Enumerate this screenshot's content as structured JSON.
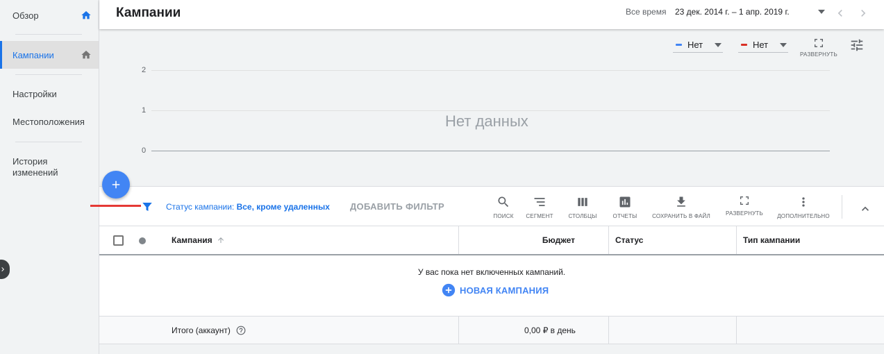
{
  "sidebar": {
    "items": [
      {
        "label": "Обзор"
      },
      {
        "label": "Кампании"
      },
      {
        "label": "Настройки"
      },
      {
        "label": "Местоположения"
      },
      {
        "label": "История изменений"
      }
    ]
  },
  "header": {
    "title": "Кампании",
    "date_label": "Все время",
    "date_range": "23 дек. 2014 г. – 1 апр. 2019 г."
  },
  "chart": {
    "metric1": "Нет",
    "metric2": "Нет",
    "metric1_color": "#4285f4",
    "metric2_color": "#d93025",
    "expand_label": "РАЗВЕРНУТЬ",
    "y_ticks": [
      "2",
      "1",
      "0"
    ],
    "no_data": "Нет данных"
  },
  "filter": {
    "prefix": "Статус кампании:",
    "value": "Все, кроме удаленных",
    "add_filter": "ДОБАВИТЬ ФИЛЬТР"
  },
  "toolbar": {
    "search": "ПОИСК",
    "segment": "СЕГМЕНТ",
    "columns": "СТОЛБЦЫ",
    "reports": "ОТЧЕТЫ",
    "download": "СОХРАНИТЬ В ФАЙЛ",
    "expand": "РАЗВЕРНУТЬ",
    "more": "ДОПОЛНИТЕЛЬНО"
  },
  "table": {
    "columns": [
      "Кампания",
      "Бюджет",
      "Статус",
      "Тип кампании"
    ],
    "empty_message": "У вас пока нет включенных кампаний.",
    "new_campaign": "НОВАЯ КАМПАНИЯ",
    "total_label": "Итого (аккаунт)",
    "total_budget": "0,00 ₽ в день"
  },
  "colors": {
    "accent": "#1a73e8",
    "fab": "#4285f4",
    "highlight": "#e53935"
  }
}
